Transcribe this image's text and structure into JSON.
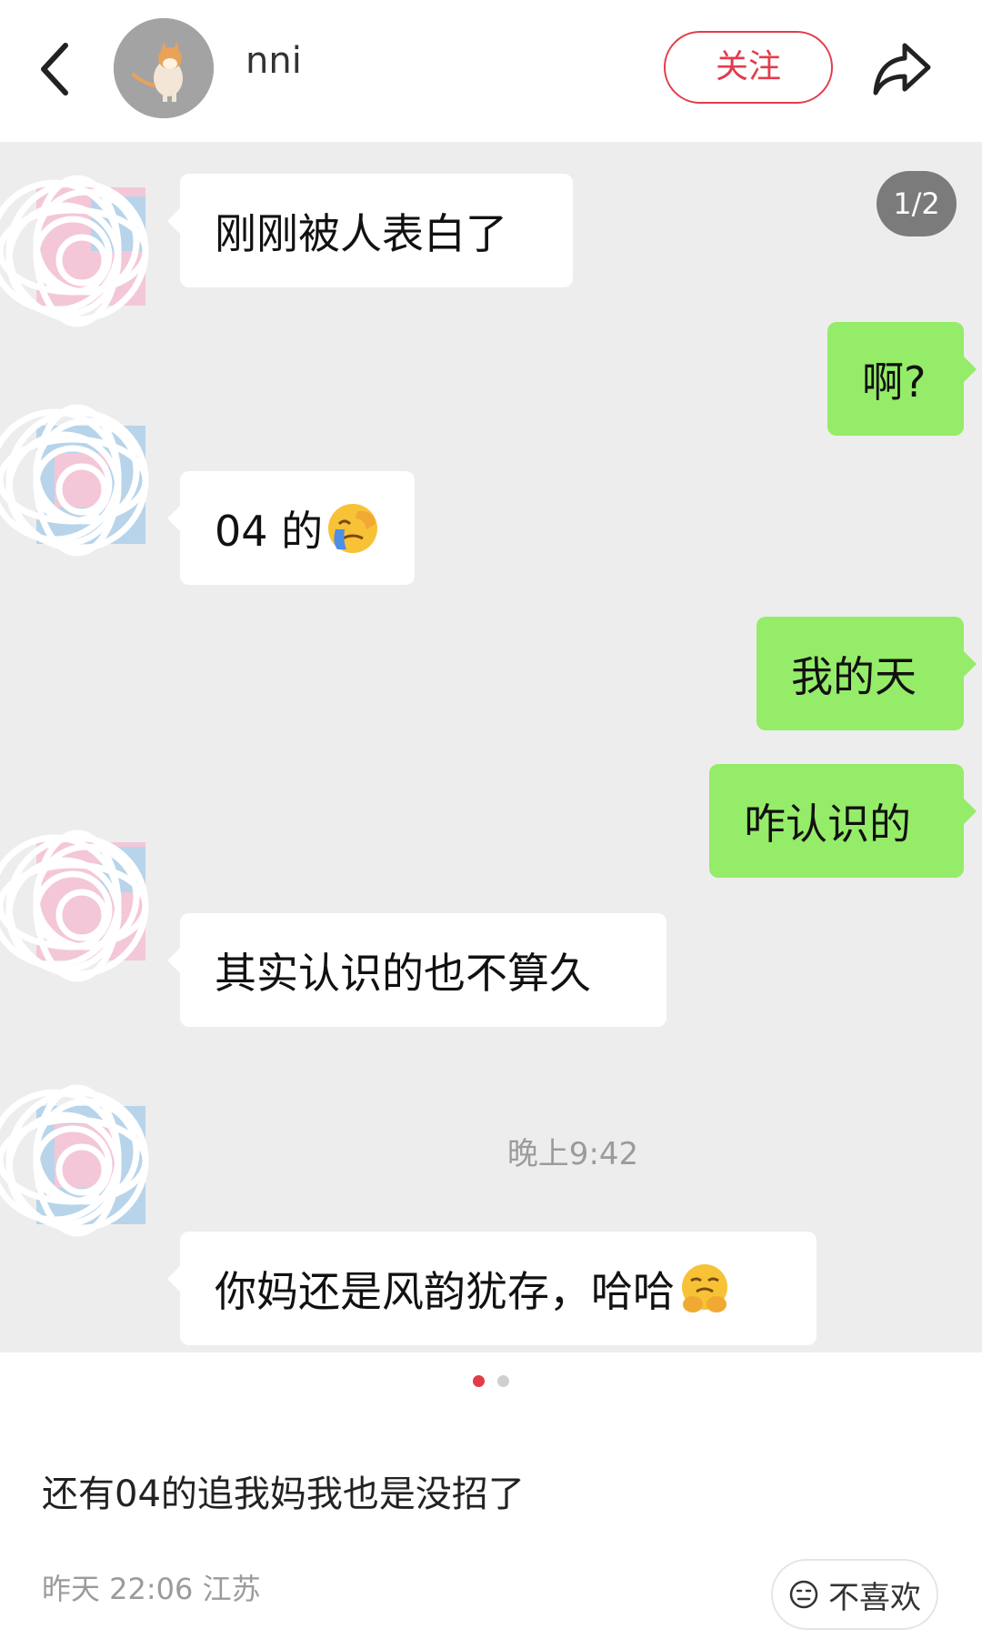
{
  "header": {
    "username": "nni",
    "follow_label": "关注"
  },
  "chat": {
    "page_indicator": "1/2",
    "messages": [
      {
        "side": "left",
        "text": "刚刚被人表白了"
      },
      {
        "side": "right",
        "text": "啊?"
      },
      {
        "side": "left",
        "text": "04 的",
        "emoji": "facepalm-crying-emoji"
      },
      {
        "side": "right",
        "text": "我的天"
      },
      {
        "side": "right",
        "text": "咋认识的"
      },
      {
        "side": "left",
        "text": "其实认识的也不算久"
      },
      {
        "side": "left",
        "text": "你妈还是风韵犹存，哈哈",
        "emoji": "grimacing-hands-emoji"
      }
    ],
    "timestamp": "晚上9:42"
  },
  "carousel": {
    "active_index": 0,
    "count": 2
  },
  "post": {
    "caption": "还有04的追我妈我也是没招了",
    "meta": "昨天 22:06 江苏",
    "dislike_label": "不喜欢"
  },
  "colors": {
    "accent_red": "#e23c4b",
    "bubble_green": "#95ec69",
    "chat_bg": "#ededed"
  }
}
